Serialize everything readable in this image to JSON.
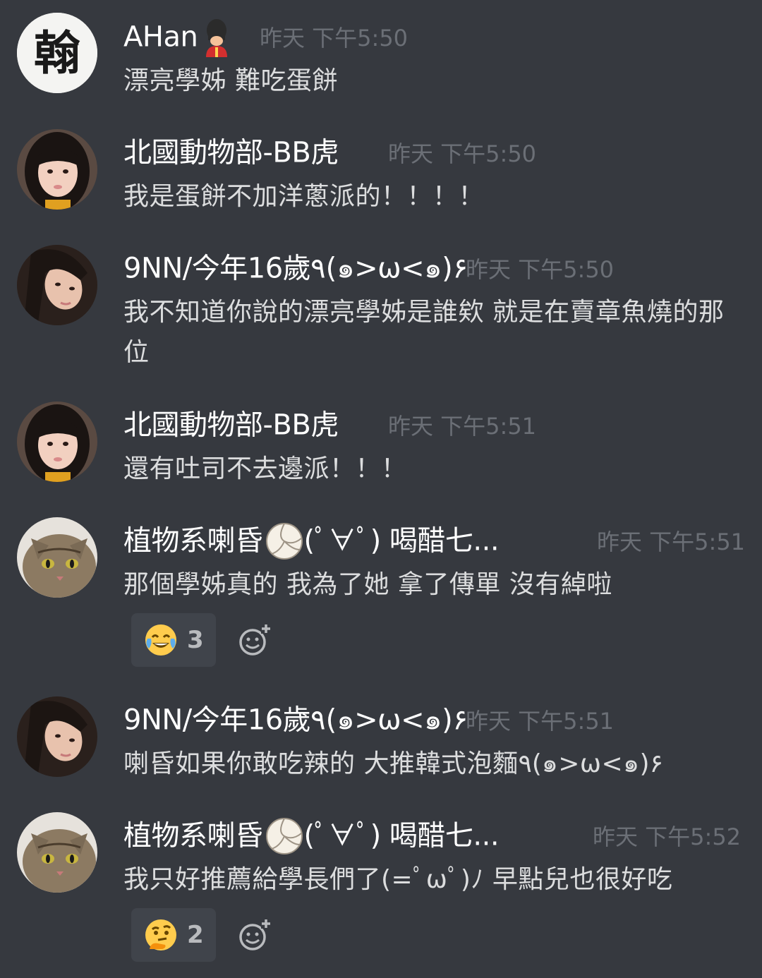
{
  "messages": [
    {
      "username": "AHan",
      "timestamp": "昨天 下午5:50",
      "text": "漂亮學姊 難吃蛋餅",
      "avatar": {
        "icon": "calligraphy-avatar",
        "label": "翰"
      },
      "badge_icon": "guardsman-emoji-icon"
    },
    {
      "username": "北國動物部-BB虎",
      "timestamp": "昨天 下午5:50",
      "text": "我是蛋餅不加洋蔥派的！！！！",
      "avatar": {
        "icon": "girl-photo-avatar"
      }
    },
    {
      "username": "9NN/今年16歲٩(๑>ω<๑)۶",
      "timestamp": "昨天 下午5:50",
      "text": "我不知道你說的漂亮學姊是誰欸 就是在賣章魚燒的那位",
      "avatar": {
        "icon": "girl-photo-avatar"
      }
    },
    {
      "username": "北國動物部-BB虎",
      "timestamp": "昨天 下午5:51",
      "text": "還有吐司不去邊派！！！",
      "avatar": {
        "icon": "girl-photo-avatar"
      }
    },
    {
      "username": "植物系喇昏",
      "username_suffix": "(ﾟ∀ﾟ) 喝醋七...",
      "timestamp": "昨天 下午5:51",
      "text": "那個學姊真的 我為了她 拿了傳單 沒有綽啦",
      "avatar": {
        "icon": "cat-photo-avatar"
      },
      "badge_icon": "volleyball-emoji-icon",
      "reaction": {
        "emoji": "joy-emoji-icon",
        "count": "3"
      }
    },
    {
      "username": "9NN/今年16歲٩(๑>ω<๑)۶",
      "timestamp": "昨天 下午5:51",
      "text": "喇昏如果你敢吃辣的 大推韓式泡麵٩(๑>ω<๑)۶",
      "avatar": {
        "icon": "girl-photo-avatar"
      }
    },
    {
      "username": "植物系喇昏",
      "username_suffix": "(ﾟ∀ﾟ) 喝醋七...",
      "timestamp": "昨天 下午5:52",
      "text": "我只好推薦給學長們了(=ﾟωﾟ)ﾉ 早點兒也很好吃",
      "avatar": {
        "icon": "cat-photo-avatar"
      },
      "badge_icon": "volleyball-emoji-icon",
      "reaction": {
        "emoji": "thinking-emoji-icon",
        "count": "2"
      }
    }
  ],
  "add_reaction_icon": "add-reaction-icon",
  "colors": {
    "background": "#36393f",
    "username": "#ffffff",
    "timestamp": "#6b6f76",
    "message_text": "#dcddde",
    "reaction_bg": "#40444b",
    "reaction_count": "#b9bbbe"
  }
}
